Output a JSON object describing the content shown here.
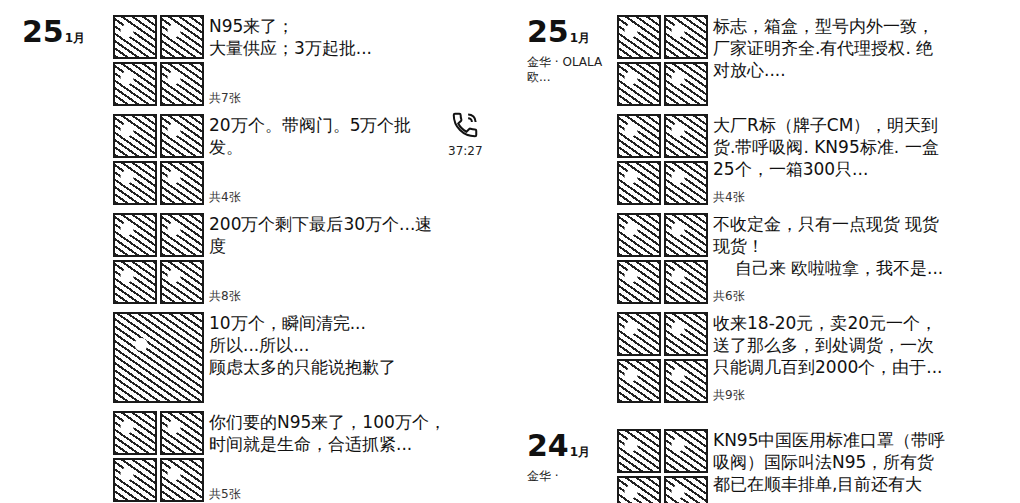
{
  "columns": [
    {
      "days": [
        {
          "day": "25",
          "month": "1月",
          "location": "",
          "entries": [
            {
              "kind": "grid",
              "lines": [
                "N95来了；",
                "大量供应；3万起批..."
              ],
              "count": "共7张"
            },
            {
              "kind": "grid",
              "lines": [
                "20万个。带阀门。5万个批",
                "发。"
              ],
              "count": "共4张"
            },
            {
              "kind": "grid",
              "lines": [
                "200万个剩下最后30万个...速",
                "度"
              ],
              "count": "共8张"
            },
            {
              "kind": "single",
              "lines": [
                "10万个，瞬间清完...",
                "所以...所以...",
                "顾虑太多的只能说抱歉了"
              ],
              "count": ""
            },
            {
              "kind": "grid",
              "lines": [
                "你们要的N95来了，100万个，",
                "时间就是生命，合适抓紧..."
              ],
              "count": "共5张"
            }
          ]
        }
      ]
    },
    {
      "days": [
        {
          "day": "25",
          "month": "1月",
          "location": "金华 · OLALA欧...",
          "entries": [
            {
              "kind": "grid",
              "lines": [
                "标志，箱盒，型号内外一致，",
                "厂家证明齐全.有代理授权. 绝",
                "对放心...."
              ],
              "count": ""
            },
            {
              "kind": "grid",
              "lines": [
                "大厂R标（牌子CM），明天到",
                "货.带呼吸阀. KN95标准. 一盒",
                "25个，一箱300只..."
              ],
              "count": "共4张"
            },
            {
              "kind": "grid",
              "lines": [
                "不收定金，只有一点现货 现货",
                "现货！",
                "    自己来 欧啦啦拿，我不是..."
              ],
              "count": "共6张"
            },
            {
              "kind": "grid",
              "lines": [
                "收来18-20元，卖20元一个，",
                "送了那么多，到处调货，一次",
                "只能调几百到2000个，由于..."
              ],
              "count": "共9张"
            }
          ]
        },
        {
          "day": "24",
          "month": "1月",
          "location": "金华 ·",
          "entries": [
            {
              "kind": "grid",
              "lines": [
                "KN95中国医用标准口罩（带呼",
                "吸阀）国际叫法N95，所有货",
                "都已在顺丰排单,目前还有大"
              ],
              "count": ""
            }
          ]
        }
      ]
    }
  ],
  "call": {
    "time": "37:27"
  }
}
